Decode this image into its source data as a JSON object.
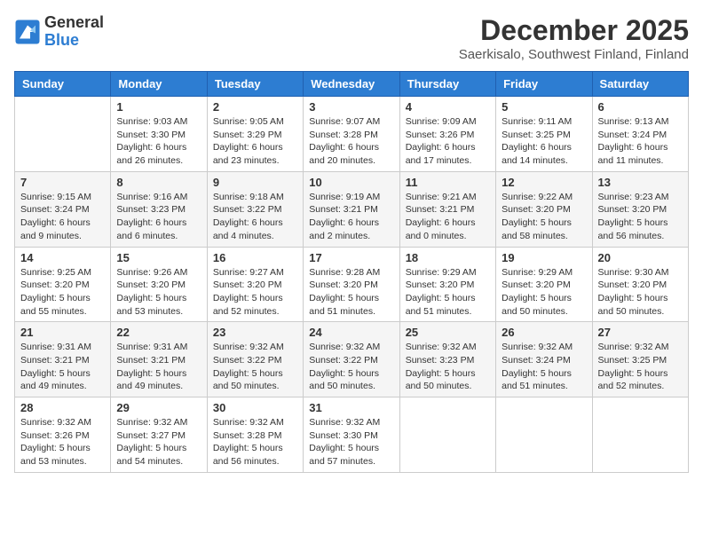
{
  "logo": {
    "general": "General",
    "blue": "Blue"
  },
  "header": {
    "month": "December 2025",
    "location": "Saerkisalo, Southwest Finland, Finland"
  },
  "weekdays": [
    "Sunday",
    "Monday",
    "Tuesday",
    "Wednesday",
    "Thursday",
    "Friday",
    "Saturday"
  ],
  "weeks": [
    [
      {
        "day": "",
        "info": ""
      },
      {
        "day": "1",
        "info": "Sunrise: 9:03 AM\nSunset: 3:30 PM\nDaylight: 6 hours\nand 26 minutes."
      },
      {
        "day": "2",
        "info": "Sunrise: 9:05 AM\nSunset: 3:29 PM\nDaylight: 6 hours\nand 23 minutes."
      },
      {
        "day": "3",
        "info": "Sunrise: 9:07 AM\nSunset: 3:28 PM\nDaylight: 6 hours\nand 20 minutes."
      },
      {
        "day": "4",
        "info": "Sunrise: 9:09 AM\nSunset: 3:26 PM\nDaylight: 6 hours\nand 17 minutes."
      },
      {
        "day": "5",
        "info": "Sunrise: 9:11 AM\nSunset: 3:25 PM\nDaylight: 6 hours\nand 14 minutes."
      },
      {
        "day": "6",
        "info": "Sunrise: 9:13 AM\nSunset: 3:24 PM\nDaylight: 6 hours\nand 11 minutes."
      }
    ],
    [
      {
        "day": "7",
        "info": "Sunrise: 9:15 AM\nSunset: 3:24 PM\nDaylight: 6 hours\nand 9 minutes."
      },
      {
        "day": "8",
        "info": "Sunrise: 9:16 AM\nSunset: 3:23 PM\nDaylight: 6 hours\nand 6 minutes."
      },
      {
        "day": "9",
        "info": "Sunrise: 9:18 AM\nSunset: 3:22 PM\nDaylight: 6 hours\nand 4 minutes."
      },
      {
        "day": "10",
        "info": "Sunrise: 9:19 AM\nSunset: 3:21 PM\nDaylight: 6 hours\nand 2 minutes."
      },
      {
        "day": "11",
        "info": "Sunrise: 9:21 AM\nSunset: 3:21 PM\nDaylight: 6 hours\nand 0 minutes."
      },
      {
        "day": "12",
        "info": "Sunrise: 9:22 AM\nSunset: 3:20 PM\nDaylight: 5 hours\nand 58 minutes."
      },
      {
        "day": "13",
        "info": "Sunrise: 9:23 AM\nSunset: 3:20 PM\nDaylight: 5 hours\nand 56 minutes."
      }
    ],
    [
      {
        "day": "14",
        "info": "Sunrise: 9:25 AM\nSunset: 3:20 PM\nDaylight: 5 hours\nand 55 minutes."
      },
      {
        "day": "15",
        "info": "Sunrise: 9:26 AM\nSunset: 3:20 PM\nDaylight: 5 hours\nand 53 minutes."
      },
      {
        "day": "16",
        "info": "Sunrise: 9:27 AM\nSunset: 3:20 PM\nDaylight: 5 hours\nand 52 minutes."
      },
      {
        "day": "17",
        "info": "Sunrise: 9:28 AM\nSunset: 3:20 PM\nDaylight: 5 hours\nand 51 minutes."
      },
      {
        "day": "18",
        "info": "Sunrise: 9:29 AM\nSunset: 3:20 PM\nDaylight: 5 hours\nand 51 minutes."
      },
      {
        "day": "19",
        "info": "Sunrise: 9:29 AM\nSunset: 3:20 PM\nDaylight: 5 hours\nand 50 minutes."
      },
      {
        "day": "20",
        "info": "Sunrise: 9:30 AM\nSunset: 3:20 PM\nDaylight: 5 hours\nand 50 minutes."
      }
    ],
    [
      {
        "day": "21",
        "info": "Sunrise: 9:31 AM\nSunset: 3:21 PM\nDaylight: 5 hours\nand 49 minutes."
      },
      {
        "day": "22",
        "info": "Sunrise: 9:31 AM\nSunset: 3:21 PM\nDaylight: 5 hours\nand 49 minutes."
      },
      {
        "day": "23",
        "info": "Sunrise: 9:32 AM\nSunset: 3:22 PM\nDaylight: 5 hours\nand 50 minutes."
      },
      {
        "day": "24",
        "info": "Sunrise: 9:32 AM\nSunset: 3:22 PM\nDaylight: 5 hours\nand 50 minutes."
      },
      {
        "day": "25",
        "info": "Sunrise: 9:32 AM\nSunset: 3:23 PM\nDaylight: 5 hours\nand 50 minutes."
      },
      {
        "day": "26",
        "info": "Sunrise: 9:32 AM\nSunset: 3:24 PM\nDaylight: 5 hours\nand 51 minutes."
      },
      {
        "day": "27",
        "info": "Sunrise: 9:32 AM\nSunset: 3:25 PM\nDaylight: 5 hours\nand 52 minutes."
      }
    ],
    [
      {
        "day": "28",
        "info": "Sunrise: 9:32 AM\nSunset: 3:26 PM\nDaylight: 5 hours\nand 53 minutes."
      },
      {
        "day": "29",
        "info": "Sunrise: 9:32 AM\nSunset: 3:27 PM\nDaylight: 5 hours\nand 54 minutes."
      },
      {
        "day": "30",
        "info": "Sunrise: 9:32 AM\nSunset: 3:28 PM\nDaylight: 5 hours\nand 56 minutes."
      },
      {
        "day": "31",
        "info": "Sunrise: 9:32 AM\nSunset: 3:30 PM\nDaylight: 5 hours\nand 57 minutes."
      },
      {
        "day": "",
        "info": ""
      },
      {
        "day": "",
        "info": ""
      },
      {
        "day": "",
        "info": ""
      }
    ]
  ]
}
